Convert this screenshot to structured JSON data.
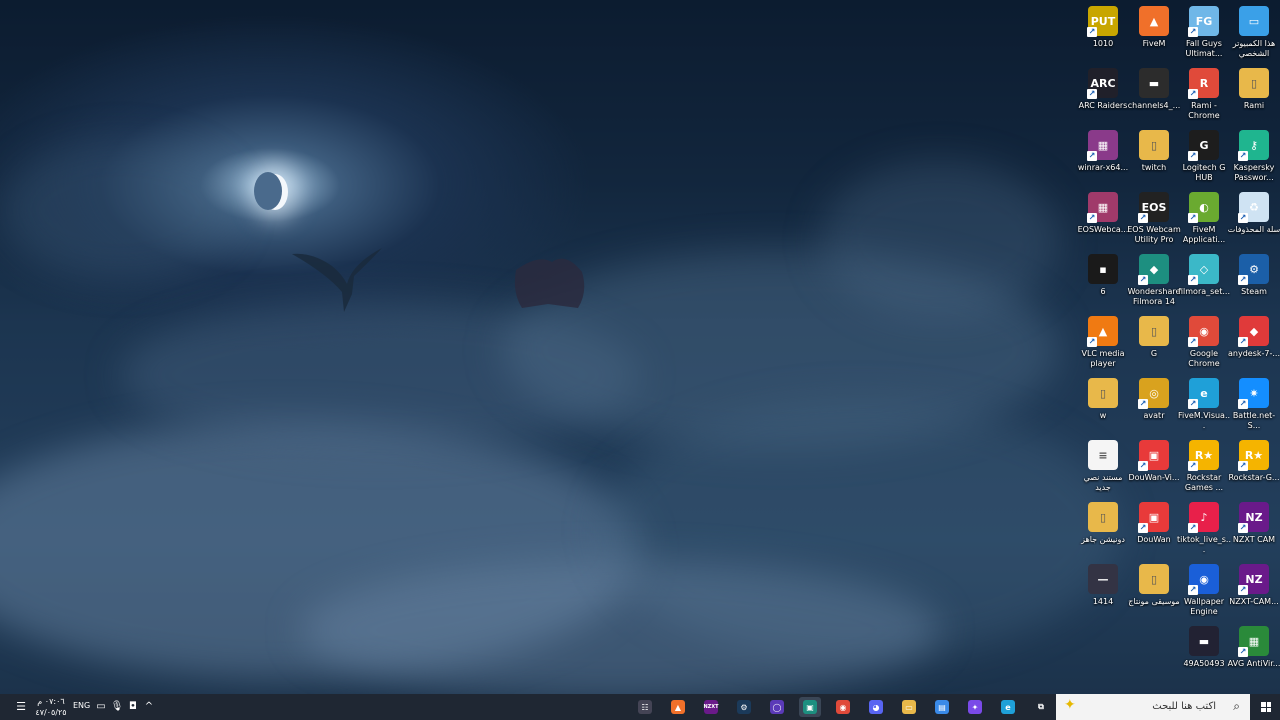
{
  "desktop": {
    "icons": [
      {
        "label": "1010",
        "icon": "game-shortcut-icon",
        "color": "#c8a600"
      },
      {
        "label": "FiveM",
        "icon": "fivem-icon",
        "color": "#f0702a"
      },
      {
        "label": "Fall Guys Ultimat...",
        "icon": "fall-guys-icon",
        "color": "#6fb7e8"
      },
      {
        "label": "هذا الكمبيوتر الشخصي",
        "icon": "this-pc-icon",
        "color": "#3aa0e8"
      },
      {
        "label": "ARC Raiders",
        "icon": "arc-raiders-icon",
        "color": "#20202a"
      },
      {
        "label": "channels4_...",
        "icon": "image-file-icon",
        "color": "#2c2c2c"
      },
      {
        "label": "Rami - Chrome",
        "icon": "chrome-profile-icon",
        "color": "#e04a3a"
      },
      {
        "label": "Rami",
        "icon": "folder-icon",
        "color": "#e8b84a"
      },
      {
        "label": "winrar-x64...",
        "icon": "winrar-icon",
        "color": "#8a3a8a"
      },
      {
        "label": "twitch",
        "icon": "folder-icon",
        "color": "#e8b84a"
      },
      {
        "label": "Logitech G HUB",
        "icon": "logitech-ghub-icon",
        "color": "#1d1d1d"
      },
      {
        "label": "Kaspersky Passwor...",
        "icon": "kaspersky-password-icon",
        "color": "#1fb58f"
      },
      {
        "label": "EOSWebca...",
        "icon": "winrar-archive-icon",
        "color": "#a03a6a"
      },
      {
        "label": "EOS Webcam Utility Pro",
        "icon": "eos-webcam-icon",
        "color": "#222222"
      },
      {
        "label": "FiveM Applicati...",
        "icon": "fivem-application-icon",
        "color": "#6aaa30"
      },
      {
        "label": "سلة المحذوفات",
        "icon": "recycle-bin-icon",
        "color": "#cfe3f3"
      },
      {
        "label": "6",
        "icon": "image-file-icon",
        "color": "#1a1a1a"
      },
      {
        "label": "Wondershare Filmora 14",
        "icon": "filmora-icon",
        "color": "#1d8f80"
      },
      {
        "label": "filmora_set...",
        "icon": "installer-icon",
        "color": "#3bb8c8"
      },
      {
        "label": "Steam",
        "icon": "steam-icon",
        "color": "#1b5fa8"
      },
      {
        "label": "VLC media player",
        "icon": "vlc-icon",
        "color": "#f07a12"
      },
      {
        "label": "G",
        "icon": "folder-icon",
        "color": "#e8b84a"
      },
      {
        "label": "Google Chrome",
        "icon": "chrome-icon",
        "color": "#e04a3a"
      },
      {
        "label": "anydesk-7-...",
        "icon": "anydesk-icon",
        "color": "#e03a3a"
      },
      {
        "label": "w",
        "icon": "folder-icon",
        "color": "#e8b84a"
      },
      {
        "label": "avatr",
        "icon": "avatr-icon",
        "color": "#d9a21e"
      },
      {
        "label": "FiveM.Visua...",
        "icon": "edge-file-icon",
        "color": "#1fa0d8"
      },
      {
        "label": "Battle.net-S...",
        "icon": "battlenet-icon",
        "color": "#148eff"
      },
      {
        "label": "مستند نصي جديد",
        "icon": "text-document-icon",
        "color": "#f5f5f5"
      },
      {
        "label": "DouWan-Vi...",
        "icon": "douwan-icon",
        "color": "#e83a3a"
      },
      {
        "label": "Rockstar Games ...",
        "icon": "rockstar-icon",
        "color": "#f5b400"
      },
      {
        "label": "Rockstar-G...",
        "icon": "rockstar-installer-icon",
        "color": "#f5b400"
      },
      {
        "label": "دونيشن جاهز",
        "icon": "folder-icon",
        "color": "#e8b84a"
      },
      {
        "label": "DouWan",
        "icon": "douwan-icon",
        "color": "#e83a3a"
      },
      {
        "label": "tiktok_live_s...",
        "icon": "tiktok-live-icon",
        "color": "#e8204a"
      },
      {
        "label": "NZXT CAM",
        "icon": "nzxt-icon",
        "color": "#6a1a8a"
      },
      {
        "label": "1414",
        "icon": "image-file-icon",
        "color": "#334"
      },
      {
        "label": "موسيقى مونتاج",
        "icon": "folder-icon",
        "color": "#e8b84a"
      },
      {
        "label": "Wallpaper Engine",
        "icon": "wallpaper-engine-icon",
        "color": "#1a5fd8"
      },
      {
        "label": "NZXT-CAM...",
        "icon": "nzxt-installer-icon",
        "color": "#6a1a8a"
      },
      {
        "label": "",
        "icon": "",
        "color": ""
      },
      {
        "label": "",
        "icon": "",
        "color": ""
      },
      {
        "label": "49A50493",
        "icon": "image-file-icon",
        "color": "#223"
      },
      {
        "label": "AVG AntiVir...",
        "icon": "avg-antivirus-icon",
        "color": "#2a8a3a"
      }
    ],
    "icon_glyphs": {
      "1010": "PUT",
      "FiveM": "▲",
      "Fall Guys Ultimat...": "FG",
      "هذا الكمبيوتر الشخصي": "▭",
      "ARC Raiders": "ARC",
      "channels4_...": "▬",
      "Rami - Chrome": "R",
      "Rami": "▯",
      "winrar-x64...": "▦",
      "twitch": "▯",
      "Logitech G HUB": "G",
      "Kaspersky Passwor...": "⚷",
      "EOSWebca...": "▦",
      "EOS Webcam Utility Pro": "EOS",
      "FiveM Applicati...": "◐",
      "سلة المحذوفات": "♻",
      "6": "▪",
      "Wondershare Filmora 14": "◆",
      "filmora_set...": "◇",
      "Steam": "⚙",
      "VLC media player": "▲",
      "G": "▯",
      "Google Chrome": "◉",
      "anydesk-7-...": "◆",
      "w": "▯",
      "avatr": "◎",
      "FiveM.Visua...": "e",
      "Battle.net-S...": "✷",
      "مستند نصي جديد": "≡",
      "DouWan-Vi...": "▣",
      "Rockstar Games ...": "R★",
      "Rockstar-G...": "R★",
      "دونيشن جاهز": "▯",
      "DouWan": "▣",
      "tiktok_live_s...": "♪",
      "NZXT CAM": "NZ",
      "1414": "—",
      "موسيقى مونتاج": "▯",
      "Wallpaper Engine": "◉",
      "NZXT-CAM...": "NZ",
      "49A50493": "▬",
      "AVG AntiVir...": "▦"
    }
  },
  "taskbar": {
    "clock_time": "٠٧:٠٦ م",
    "clock_date": "٤٧/٠٥/٢٥",
    "language": "ENG",
    "search_placeholder": "اكتب هنا للبحث",
    "apps": [
      {
        "name": "task-view-button",
        "glyph": "⧉",
        "bg": "",
        "active": false
      },
      {
        "name": "edge-taskbar-button",
        "glyph": "e",
        "bg": "#1fa0d8",
        "active": false
      },
      {
        "name": "copilot-taskbar-button",
        "glyph": "✦",
        "bg": "#7a4ae8",
        "active": false
      },
      {
        "name": "microsoft-store-taskbar-button",
        "glyph": "▤",
        "bg": "#3a8ae8",
        "active": false
      },
      {
        "name": "file-explorer-taskbar-button",
        "glyph": "▭",
        "bg": "#e8b84a",
        "active": false
      },
      {
        "name": "discord-taskbar-button",
        "glyph": "◕",
        "bg": "#5865f2",
        "active": false
      },
      {
        "name": "chrome-taskbar-button",
        "glyph": "◉",
        "bg": "#e04a3a",
        "active": false
      },
      {
        "name": "wondershare-taskbar-button",
        "glyph": "▣",
        "bg": "#1d8f80",
        "active": true
      },
      {
        "name": "obs-taskbar-button",
        "glyph": "◯",
        "bg": "#5a3ab8",
        "active": false
      },
      {
        "name": "steam-taskbar-button",
        "glyph": "⚙",
        "bg": "#1b3a5a",
        "active": false
      },
      {
        "name": "nzxt-taskbar-button",
        "glyph": "NZXT",
        "bg": "#6a1a8a",
        "active": false
      },
      {
        "name": "fivem-taskbar-button",
        "glyph": "▲",
        "bg": "#f0702a",
        "active": false
      },
      {
        "name": "screen-recorder-taskbar-button",
        "glyph": "☷",
        "bg": "#445",
        "active": false
      }
    ]
  }
}
